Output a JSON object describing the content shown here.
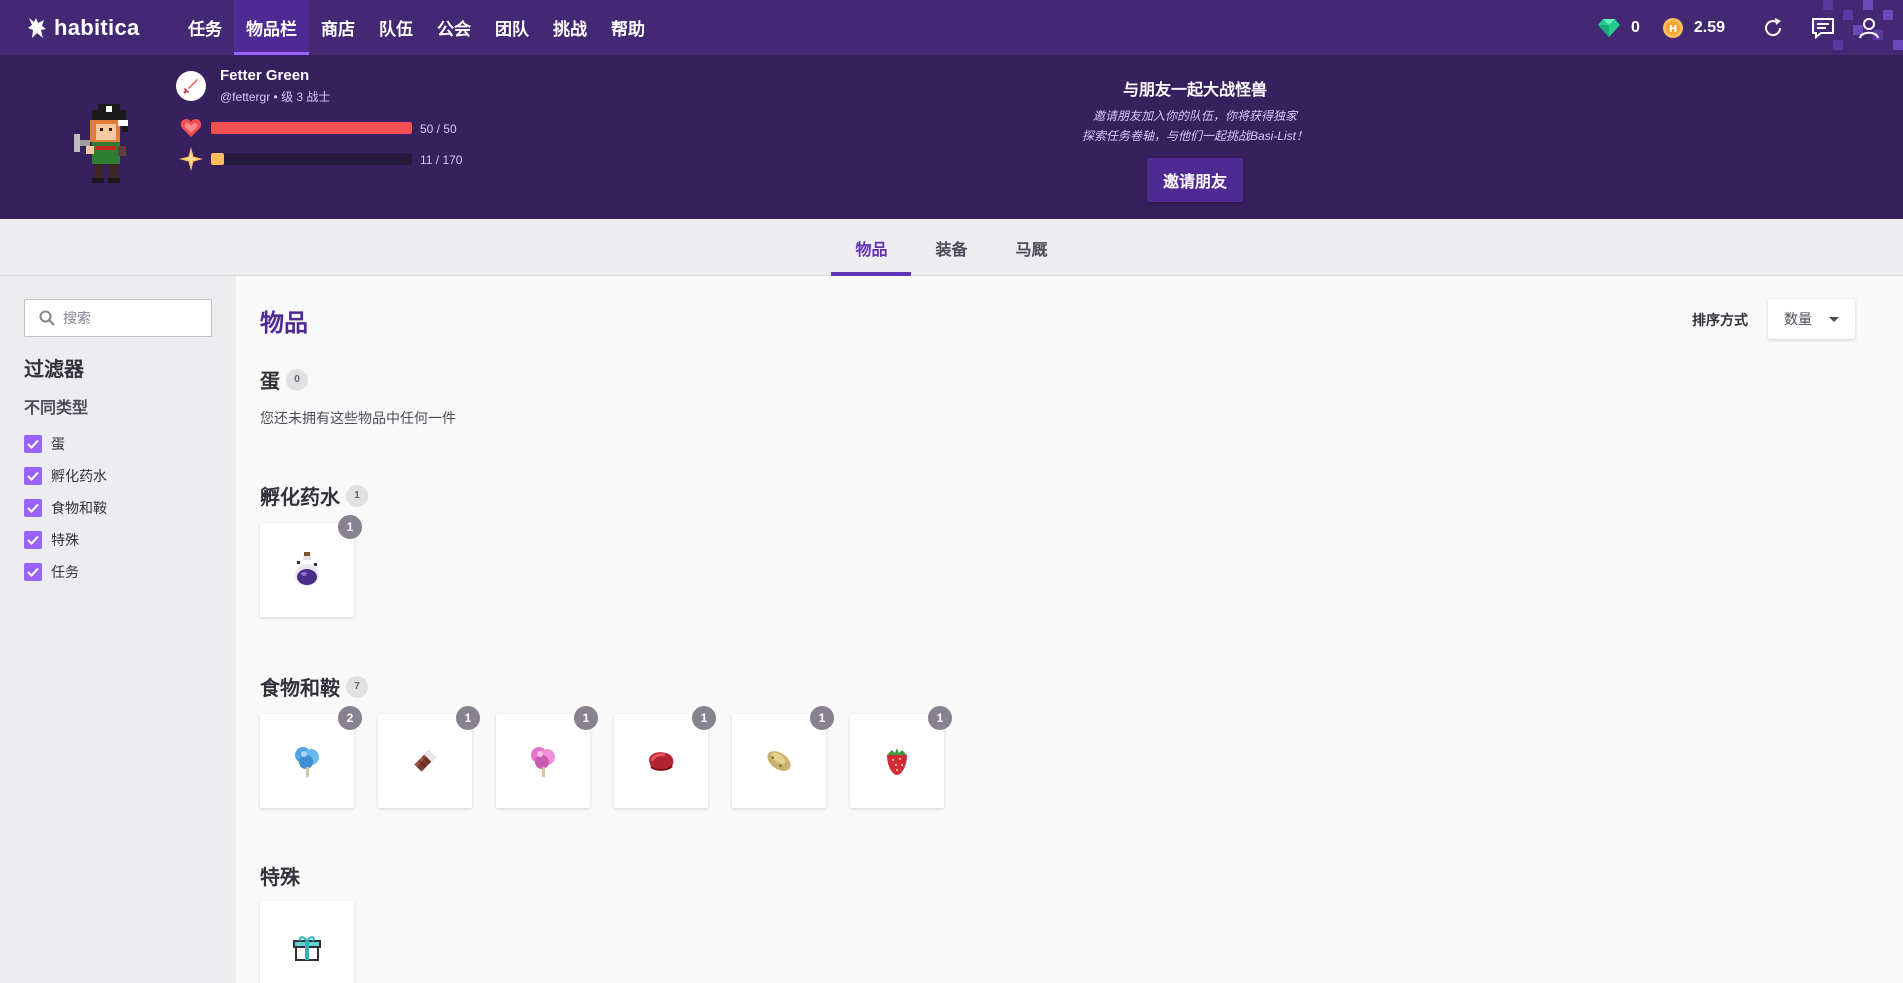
{
  "app": {
    "logo_text": "habitica"
  },
  "nav": {
    "items": [
      {
        "label": "任务"
      },
      {
        "label": "物品栏"
      },
      {
        "label": "商店"
      },
      {
        "label": "队伍"
      },
      {
        "label": "公会"
      },
      {
        "label": "团队"
      },
      {
        "label": "挑战"
      },
      {
        "label": "帮助"
      }
    ],
    "active": "物品栏",
    "gems": "0",
    "gold": "2.59"
  },
  "header": {
    "name": "Fetter Green",
    "sub": "@fettergr • 级 3 战士",
    "hp_text": "50 / 50",
    "hp_fraction": 1.0,
    "xp_text": "11 / 170",
    "xp_fraction": 0.065,
    "invite_title": "与朋友一起大战怪兽",
    "invite_desc1": "邀请朋友加入你的队伍，你将获得独家",
    "invite_desc2": "探索任务卷轴，与他们一起挑战Basi-List！",
    "invite_button": "邀请朋友"
  },
  "tabs": [
    {
      "label": "物品"
    },
    {
      "label": "装备"
    },
    {
      "label": "马厩"
    }
  ],
  "sidebar": {
    "search_placeholder": "搜索",
    "filter_title": "过滤器",
    "type_title": "不同类型",
    "filters": [
      {
        "label": "蛋"
      },
      {
        "label": "孵化药水"
      },
      {
        "label": "食物和鞍"
      },
      {
        "label": "特殊"
      },
      {
        "label": "任务"
      }
    ]
  },
  "main": {
    "title": "物品",
    "sort_label": "排序方式",
    "sort_value": "数量",
    "sections": {
      "eggs": {
        "title": "蛋",
        "count": "0",
        "empty_text": "您还未拥有这些物品中任何一件"
      },
      "potions": {
        "title": "孵化药水",
        "count": "1",
        "items": [
          {
            "icon": "shadow-potion-icon",
            "qty": "1"
          }
        ]
      },
      "food": {
        "title": "食物和鞍",
        "count": "7",
        "items": [
          {
            "icon": "cotton-candy-blue-icon",
            "qty": "2"
          },
          {
            "icon": "chocolate-icon",
            "qty": "1"
          },
          {
            "icon": "cotton-candy-pink-icon",
            "qty": "1"
          },
          {
            "icon": "meat-icon",
            "qty": "1"
          },
          {
            "icon": "potatoe-icon",
            "qty": "1"
          },
          {
            "icon": "strawberry-icon",
            "qty": "1"
          }
        ]
      },
      "special": {
        "title": "特殊",
        "items": [
          {
            "icon": "gift-box-icon"
          }
        ]
      }
    }
  },
  "colors": {
    "nav_bg": "#432874",
    "header_bg": "#36205d",
    "accent": "#6133b4",
    "hp": "#f74e52",
    "xp": "#ffbe5d"
  }
}
